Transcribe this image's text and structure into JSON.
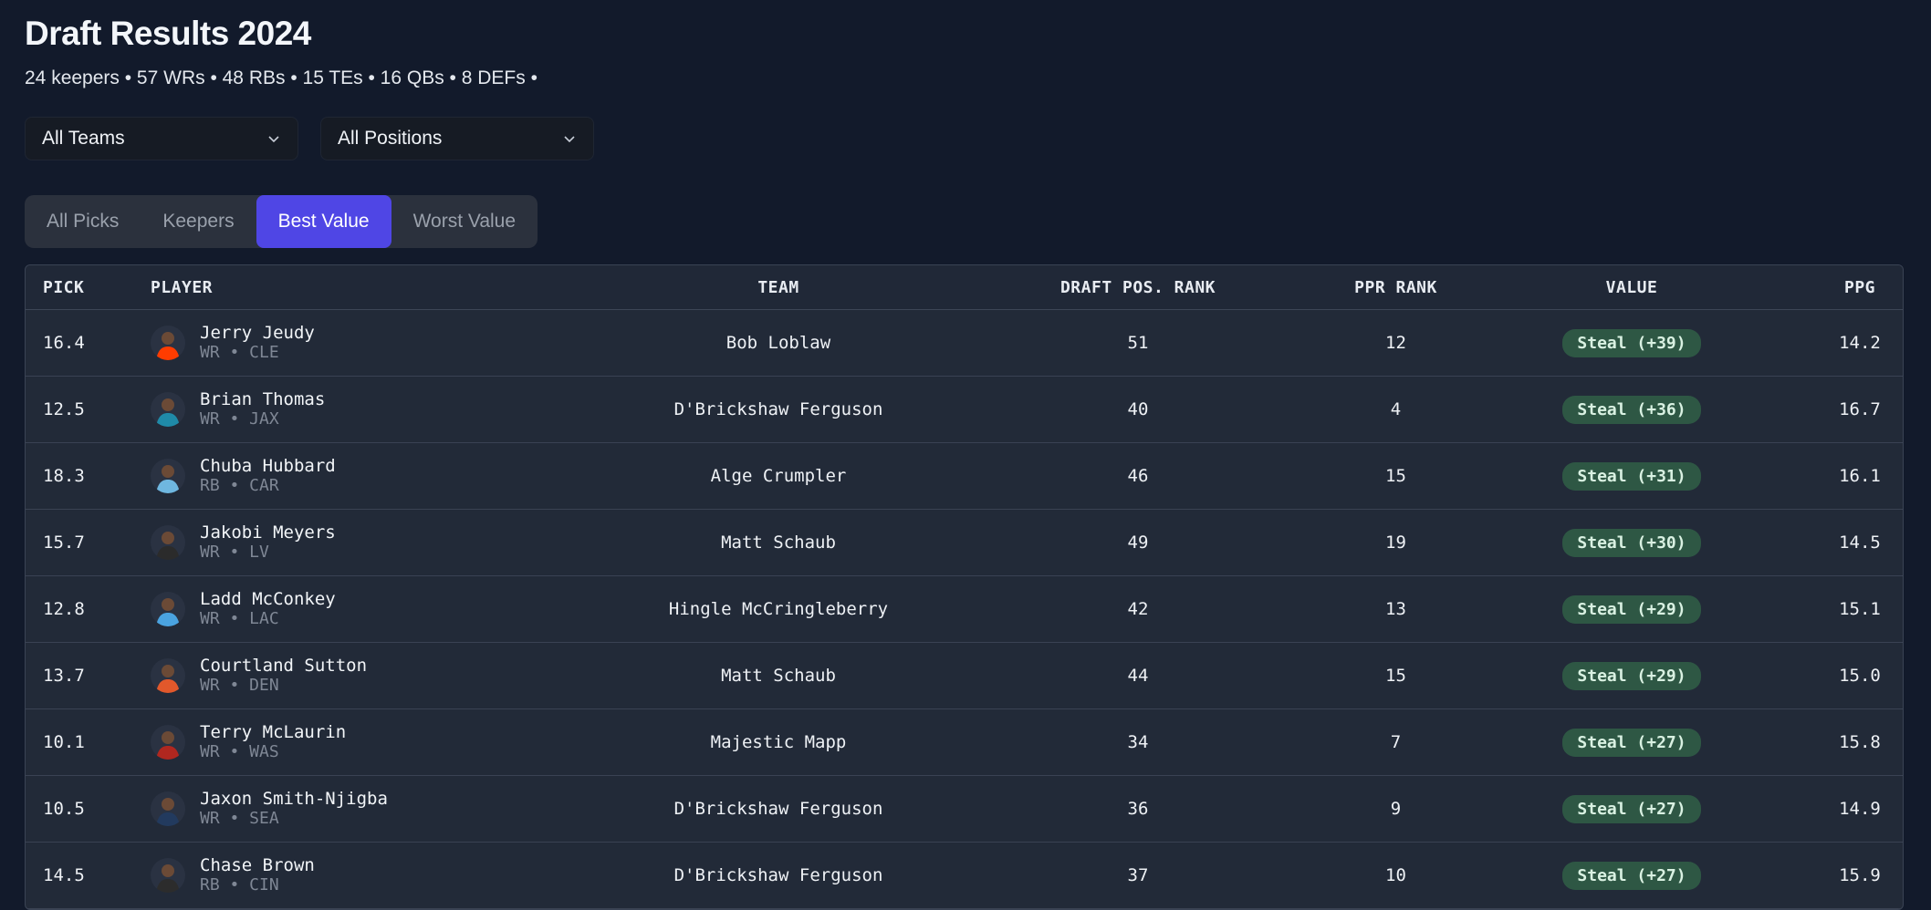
{
  "page": {
    "title": "Draft Results 2024",
    "summary": "24 keepers • 57 WRs • 48 RBs • 15 TEs • 16 QBs • 8 DEFs •"
  },
  "filters": {
    "team": "All Teams",
    "position": "All Positions"
  },
  "tabs": [
    {
      "label": "All Picks",
      "active": false
    },
    {
      "label": "Keepers",
      "active": false
    },
    {
      "label": "Best Value",
      "active": true
    },
    {
      "label": "Worst Value",
      "active": false
    }
  ],
  "table": {
    "headers": {
      "pick": "PICK",
      "player": "PLAYER",
      "team": "TEAM",
      "draft_rank": "DRAFT POS. RANK",
      "ppr_rank": "PPR RANK",
      "value": "VALUE",
      "ppg": "PPG"
    },
    "rows": [
      {
        "pick": "16.4",
        "name": "Jerry Jeudy",
        "meta": "WR • CLE",
        "team": "Bob Loblaw",
        "draft_rank": "51",
        "ppr_rank": "12",
        "value": "Steal (+39)",
        "ppg": "14.2",
        "jersey": "#ff3c00"
      },
      {
        "pick": "12.5",
        "name": "Brian Thomas",
        "meta": "WR • JAX",
        "team": "D'Brickshaw Ferguson",
        "draft_rank": "40",
        "ppr_rank": "4",
        "value": "Steal (+36)",
        "ppg": "16.7",
        "jersey": "#1f8aa8"
      },
      {
        "pick": "18.3",
        "name": "Chuba Hubbard",
        "meta": "RB • CAR",
        "team": "Alge Crumpler",
        "draft_rank": "46",
        "ppr_rank": "15",
        "value": "Steal (+31)",
        "ppg": "16.1",
        "jersey": "#6fb7e0"
      },
      {
        "pick": "15.7",
        "name": "Jakobi Meyers",
        "meta": "WR • LV",
        "team": "Matt Schaub",
        "draft_rank": "49",
        "ppr_rank": "19",
        "value": "Steal (+30)",
        "ppg": "14.5",
        "jersey": "#2b2b2b"
      },
      {
        "pick": "12.8",
        "name": "Ladd McConkey",
        "meta": "WR • LAC",
        "team": "Hingle McCringleberry",
        "draft_rank": "42",
        "ppr_rank": "13",
        "value": "Steal (+29)",
        "ppg": "15.1",
        "jersey": "#4aa3e0"
      },
      {
        "pick": "13.7",
        "name": "Courtland Sutton",
        "meta": "WR • DEN",
        "team": "Matt Schaub",
        "draft_rank": "44",
        "ppr_rank": "15",
        "value": "Steal (+29)",
        "ppg": "15.0",
        "jersey": "#e2582b"
      },
      {
        "pick": "10.1",
        "name": "Terry McLaurin",
        "meta": "WR • WAS",
        "team": "Majestic Mapp",
        "draft_rank": "34",
        "ppr_rank": "7",
        "value": "Steal (+27)",
        "ppg": "15.8",
        "jersey": "#b0271f"
      },
      {
        "pick": "10.5",
        "name": "Jaxon Smith-Njigba",
        "meta": "WR • SEA",
        "team": "D'Brickshaw Ferguson",
        "draft_rank": "36",
        "ppr_rank": "9",
        "value": "Steal (+27)",
        "ppg": "14.9",
        "jersey": "#223a5e"
      },
      {
        "pick": "14.5",
        "name": "Chase Brown",
        "meta": "RB • CIN",
        "team": "D'Brickshaw Ferguson",
        "draft_rank": "37",
        "ppr_rank": "10",
        "value": "Steal (+27)",
        "ppg": "15.9",
        "jersey": "#2c2c2c"
      }
    ]
  },
  "colors": {
    "background": "#121a2b",
    "accent": "#4f46e5",
    "steal_badge": "#2e5744"
  }
}
